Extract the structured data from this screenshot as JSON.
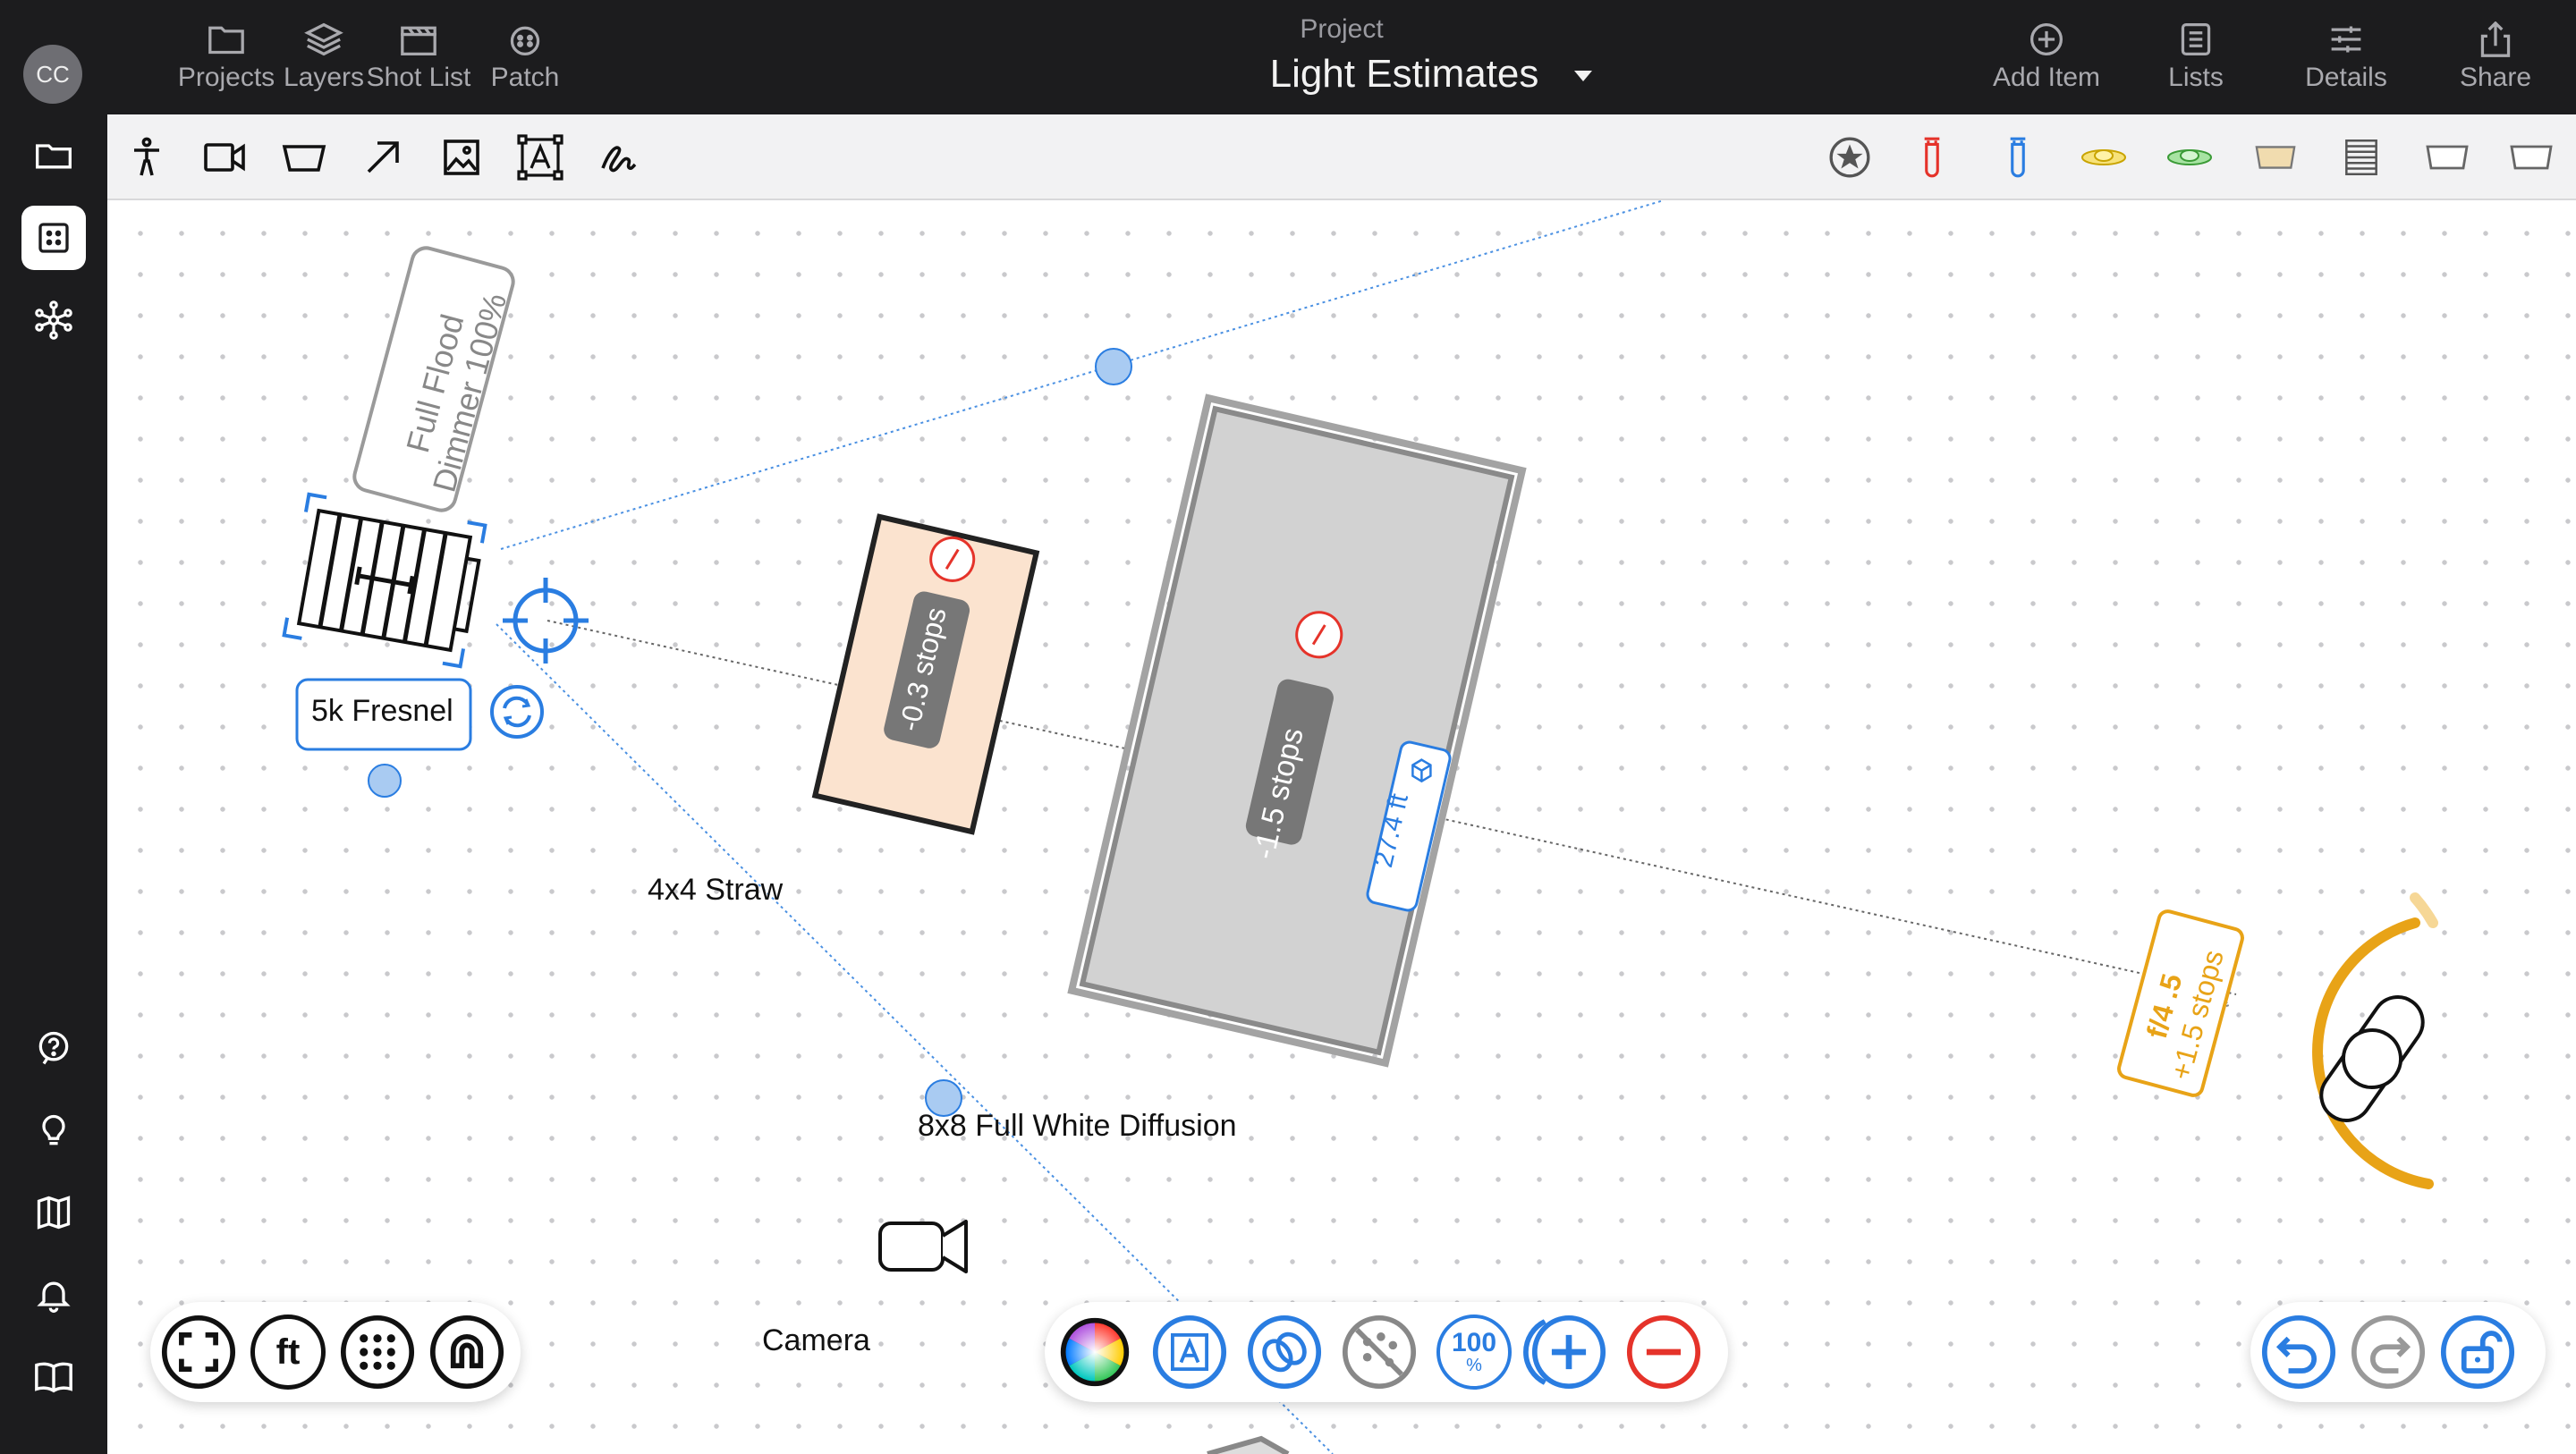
{
  "app": {
    "user_initials": "CC",
    "project_caption": "Project",
    "project_title": "Light Estimates"
  },
  "nav_left": [
    {
      "label": "Projects",
      "icon": "folder-icon"
    },
    {
      "label": "Layers",
      "icon": "layers-icon"
    },
    {
      "label": "Shot List",
      "icon": "clapperboard-icon"
    },
    {
      "label": "Patch",
      "icon": "patch-icon"
    }
  ],
  "nav_right": [
    {
      "label": "Add Item",
      "icon": "plus-circle-icon"
    },
    {
      "label": "Lists",
      "icon": "list-icon"
    },
    {
      "label": "Details",
      "icon": "sliders-icon"
    },
    {
      "label": "Share",
      "icon": "share-icon"
    }
  ],
  "rail_icons": [
    "folder-icon",
    "plot-icon",
    "network-icon",
    "help-icon",
    "lightbulb-icon",
    "map-icon",
    "bell-icon",
    "book-icon"
  ],
  "tools_left": [
    "person-tool-icon",
    "camera-tool-icon",
    "shape-tool-icon",
    "arrow-tool-icon",
    "image-tool-icon",
    "text-tool-icon",
    "draw-tool-icon"
  ],
  "tools_right": [
    "favorite-icon",
    "red-light-icon",
    "blue-light-icon",
    "yellow-led-icon",
    "green-led-icon",
    "flag-icon",
    "diffusion-frame-icon",
    "floor-shape-icon",
    "floor-shape-2-icon"
  ],
  "canvas": {
    "fixture_label": "5k Fresnel",
    "fixture_note_line1": "Full Flood",
    "fixture_note_line2": "Dimmer 100%",
    "gel_label": "4x4 Straw",
    "gel_stops": "-0.3 stops",
    "diffusion_label": "8x8 Full White Diffusion",
    "diffusion_stops": "-1.5 stops",
    "distance": "27.4 ft",
    "subject_fstop": "f/4 .5",
    "subject_stops": "+1.5 stops",
    "camera_label": "Camera"
  },
  "bottom_left": {
    "units_label": "ft"
  },
  "bottom_center": {
    "zoom_label": "100",
    "zoom_unit": "%"
  },
  "colors": {
    "accent_blue": "#1a73e8",
    "amber": "#e8a317",
    "gel_fill": "#fbe3cf",
    "danger_red": "#e5332a"
  }
}
